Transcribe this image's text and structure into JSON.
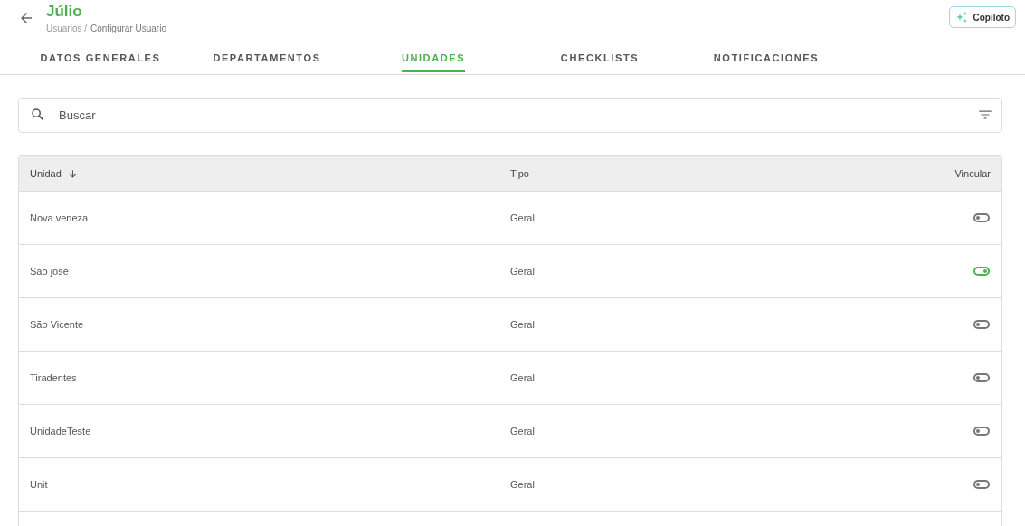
{
  "header": {
    "title": "Júlio",
    "breadcrumb": [
      "Usuarios /",
      "Configurar Usuario"
    ],
    "copilot_button": "Copiloto"
  },
  "tabs": [
    {
      "label": "DATOS GENERALES",
      "selected": false
    },
    {
      "label": "DEPARTAMENTOS",
      "selected": false
    },
    {
      "label": "UNIDADES",
      "selected": true
    },
    {
      "label": "CHECKLISTS",
      "selected": false
    },
    {
      "label": "NOTIFICACIONES",
      "selected": false
    }
  ],
  "search": {
    "placeholder": "Buscar"
  },
  "table": {
    "columns": [
      "Unidad",
      "Tipo",
      "Vincular"
    ],
    "rows": [
      {
        "unidad": "Nova veneza",
        "tipo": "Geral",
        "vincular": false
      },
      {
        "unidad": "São josé",
        "tipo": "Geral",
        "vincular": true
      },
      {
        "unidad": "São Vicente",
        "tipo": "Geral",
        "vincular": false
      },
      {
        "unidad": "Tiradentes",
        "tipo": "Geral",
        "vincular": false
      },
      {
        "unidad": "UnidadeTeste",
        "tipo": "Geral",
        "vincular": false
      },
      {
        "unidad": "Unit",
        "tipo": "Geral",
        "vincular": false
      }
    ]
  }
}
